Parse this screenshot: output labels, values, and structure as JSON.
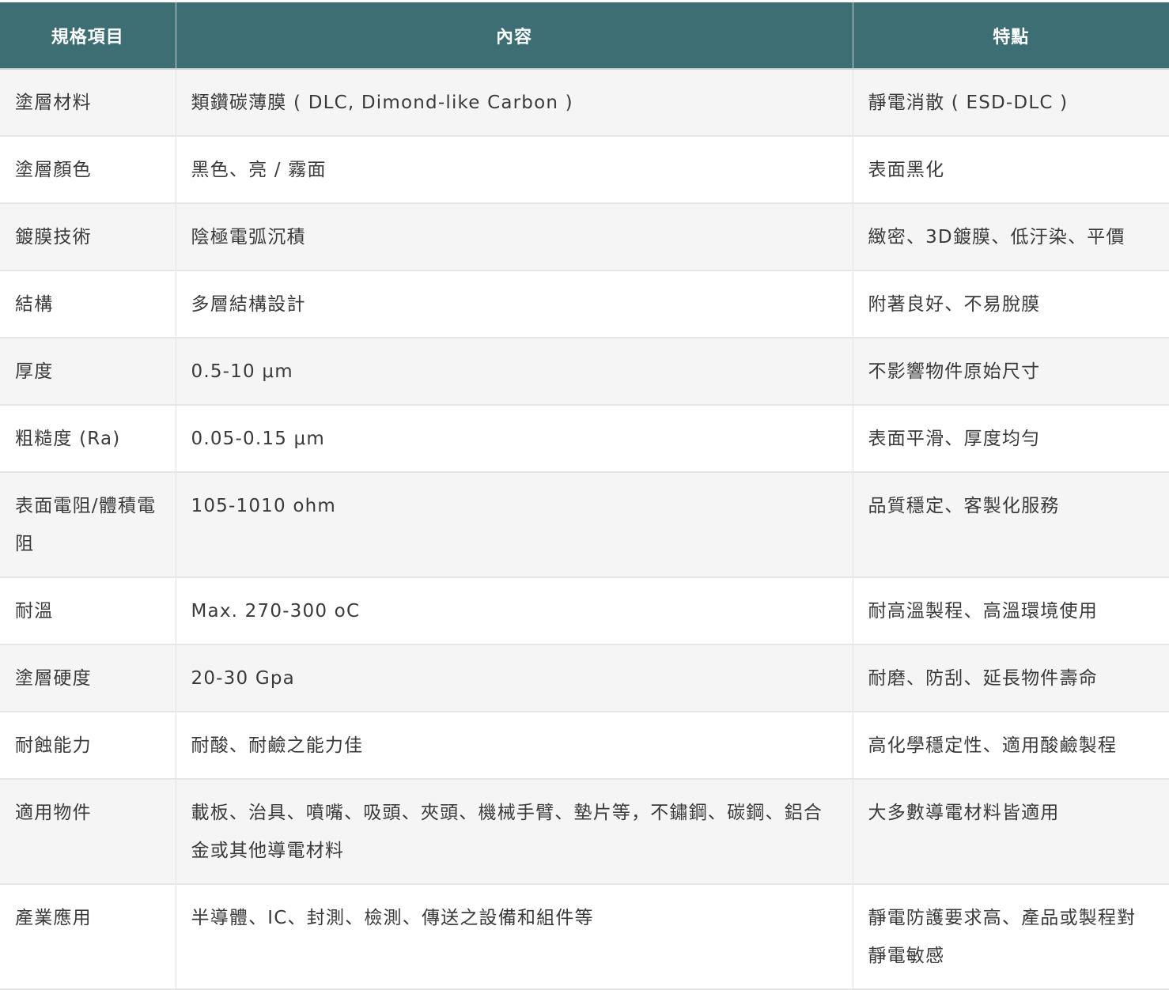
{
  "table": {
    "headers": [
      "規格項目",
      "內容",
      "特點"
    ],
    "rows": [
      [
        "塗層材料",
        "類鑽碳薄膜 ( DLC, Dimond-like Carbon )",
        "靜電消散 ( ESD-DLC )"
      ],
      [
        "塗層顏色",
        "黑色、亮 / 霧面",
        "表面黑化"
      ],
      [
        "鍍膜技術",
        "陰極電弧沉積",
        "緻密、3D鍍膜、低汙染、平價"
      ],
      [
        "結構",
        "多層結構設計",
        "附著良好、不易脫膜"
      ],
      [
        "厚度",
        "0.5-10 μm",
        "不影響物件原始尺寸"
      ],
      [
        "粗糙度 (Ra)",
        "0.05-0.15 μm",
        "表面平滑、厚度均勻"
      ],
      [
        "表面電阻/體積電阻",
        "105-1010 ohm",
        "品質穩定、客製化服務"
      ],
      [
        "耐溫",
        "Max. 270-300 oC",
        "耐高溫製程、高溫環境使用"
      ],
      [
        "塗層硬度",
        "20-30 Gpa",
        "耐磨、防刮、延長物件壽命"
      ],
      [
        "耐蝕能力",
        "耐酸、耐鹼之能力佳",
        "高化學穩定性、適用酸鹼製程"
      ],
      [
        "適用物件",
        "載板、治具、噴嘴、吸頭、夾頭、機械手臂、墊片等，不鏽鋼、碳鋼、鋁合金或其他導電材料",
        "大多數導電材料皆適用"
      ],
      [
        "產業應用",
        "半導體、IC、封測、檢測、傳送之設備和組件等",
        "靜電防護要求高、產品或製程對靜電敏感"
      ]
    ]
  }
}
